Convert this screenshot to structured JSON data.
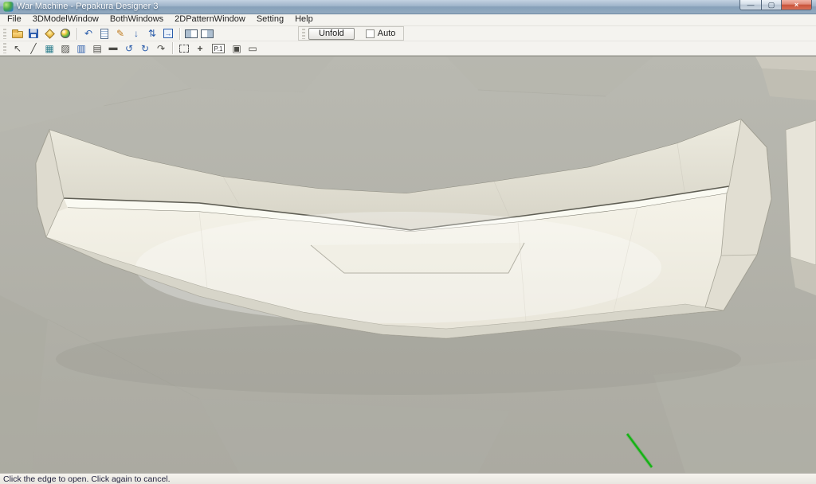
{
  "window": {
    "title": "War Machine - Pepakura Designer 3"
  },
  "menu": {
    "items": [
      "File",
      "3DModelWindow",
      "BothWindows",
      "2DPatternWindow",
      "Setting",
      "Help"
    ]
  },
  "toolbar_main": {
    "unfold_label": "Unfold",
    "auto_label": "Auto"
  },
  "toolbar_2d": {
    "page_label": "P.1"
  },
  "icons": {
    "min": "—",
    "max": "▢",
    "close": "×",
    "undo": "↶",
    "pencil": "✎",
    "arrow_down": "↓",
    "swap": "⇅",
    "export_arrow": "→",
    "select": "↖",
    "divide": "╱",
    "grid": "▦",
    "shade": "▨",
    "flap": "▥",
    "texture_face": "▤",
    "erase": "▬",
    "rotate_left": "↺",
    "rotate_right": "↻",
    "reroll": "↷",
    "crosshair": "+",
    "arrange": "▣",
    "sheet": "▭"
  },
  "status_bar": {
    "text": "Click the edge to open. Click again to cancel."
  },
  "viewport": {
    "background_color": "#b2b2a9",
    "model_color": "#f0ede2",
    "selected_edge_color": "#14b314"
  }
}
